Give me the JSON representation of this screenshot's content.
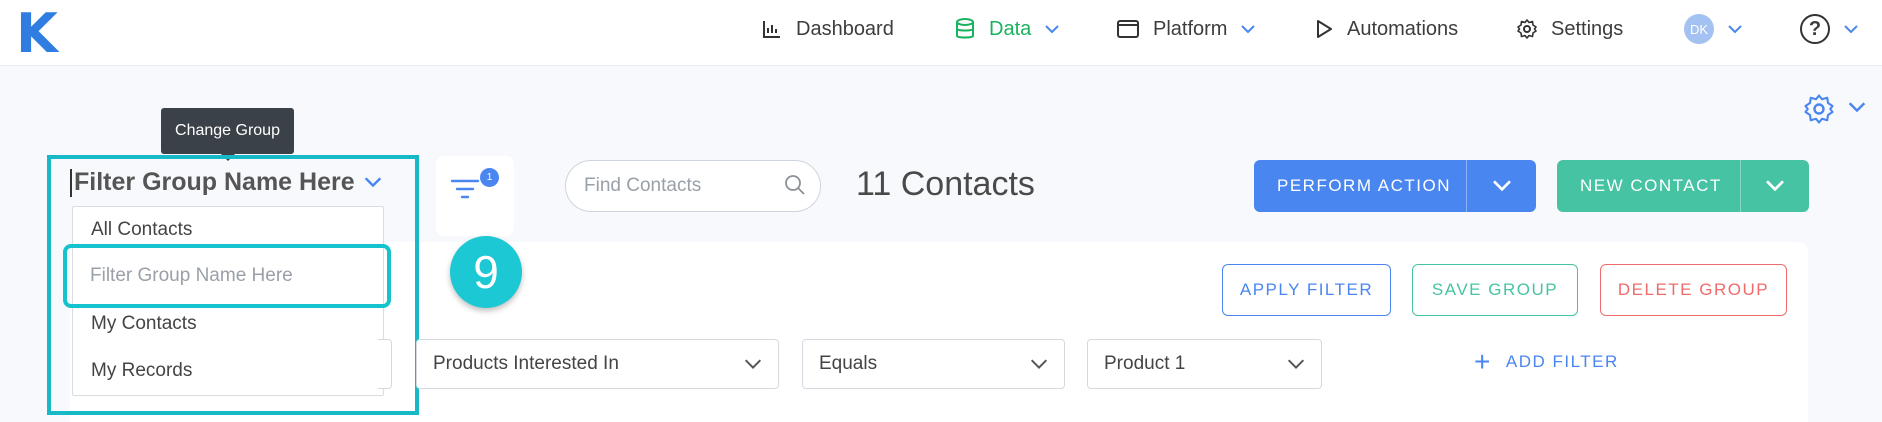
{
  "app": {
    "logo": "K"
  },
  "nav": {
    "items": [
      {
        "label": "Dashboard",
        "icon": "chart-icon"
      },
      {
        "label": "Data",
        "icon": "database-icon",
        "active": true
      },
      {
        "label": "Platform",
        "icon": "window-icon"
      },
      {
        "label": "Automations",
        "icon": "play-icon"
      },
      {
        "label": "Settings",
        "icon": "gear-icon"
      }
    ],
    "avatar_initials": "DK",
    "help_label": "?"
  },
  "tooltip": {
    "text": "Change Group"
  },
  "group": {
    "title": "Filter Group Name Here",
    "dropdown_items": [
      "All Contacts",
      "My Contacts",
      "My Records"
    ],
    "input_placeholder": "Filter Group Name Here"
  },
  "filter": {
    "badge_count": "1"
  },
  "step_badge": "9",
  "search": {
    "placeholder": "Find Contacts"
  },
  "contacts_count": "11 Contacts",
  "actions": {
    "perform_action": "PERFORM ACTION",
    "new_contact": "NEW CONTACT",
    "apply_filter": "APPLY FILTER",
    "save_group": "SAVE GROUP",
    "delete_group": "DELETE GROUP",
    "add_filter": "ADD FILTER"
  },
  "filter_row": {
    "field": "Products Interested In",
    "operator": "Equals",
    "value": "Product 1"
  },
  "colors": {
    "brand_blue": "#4a86f0",
    "brand_green": "#46c3a3",
    "danger_red": "#ef6b6b",
    "highlight_cyan": "#17b9c6",
    "nav_active": "#1ab35d"
  }
}
